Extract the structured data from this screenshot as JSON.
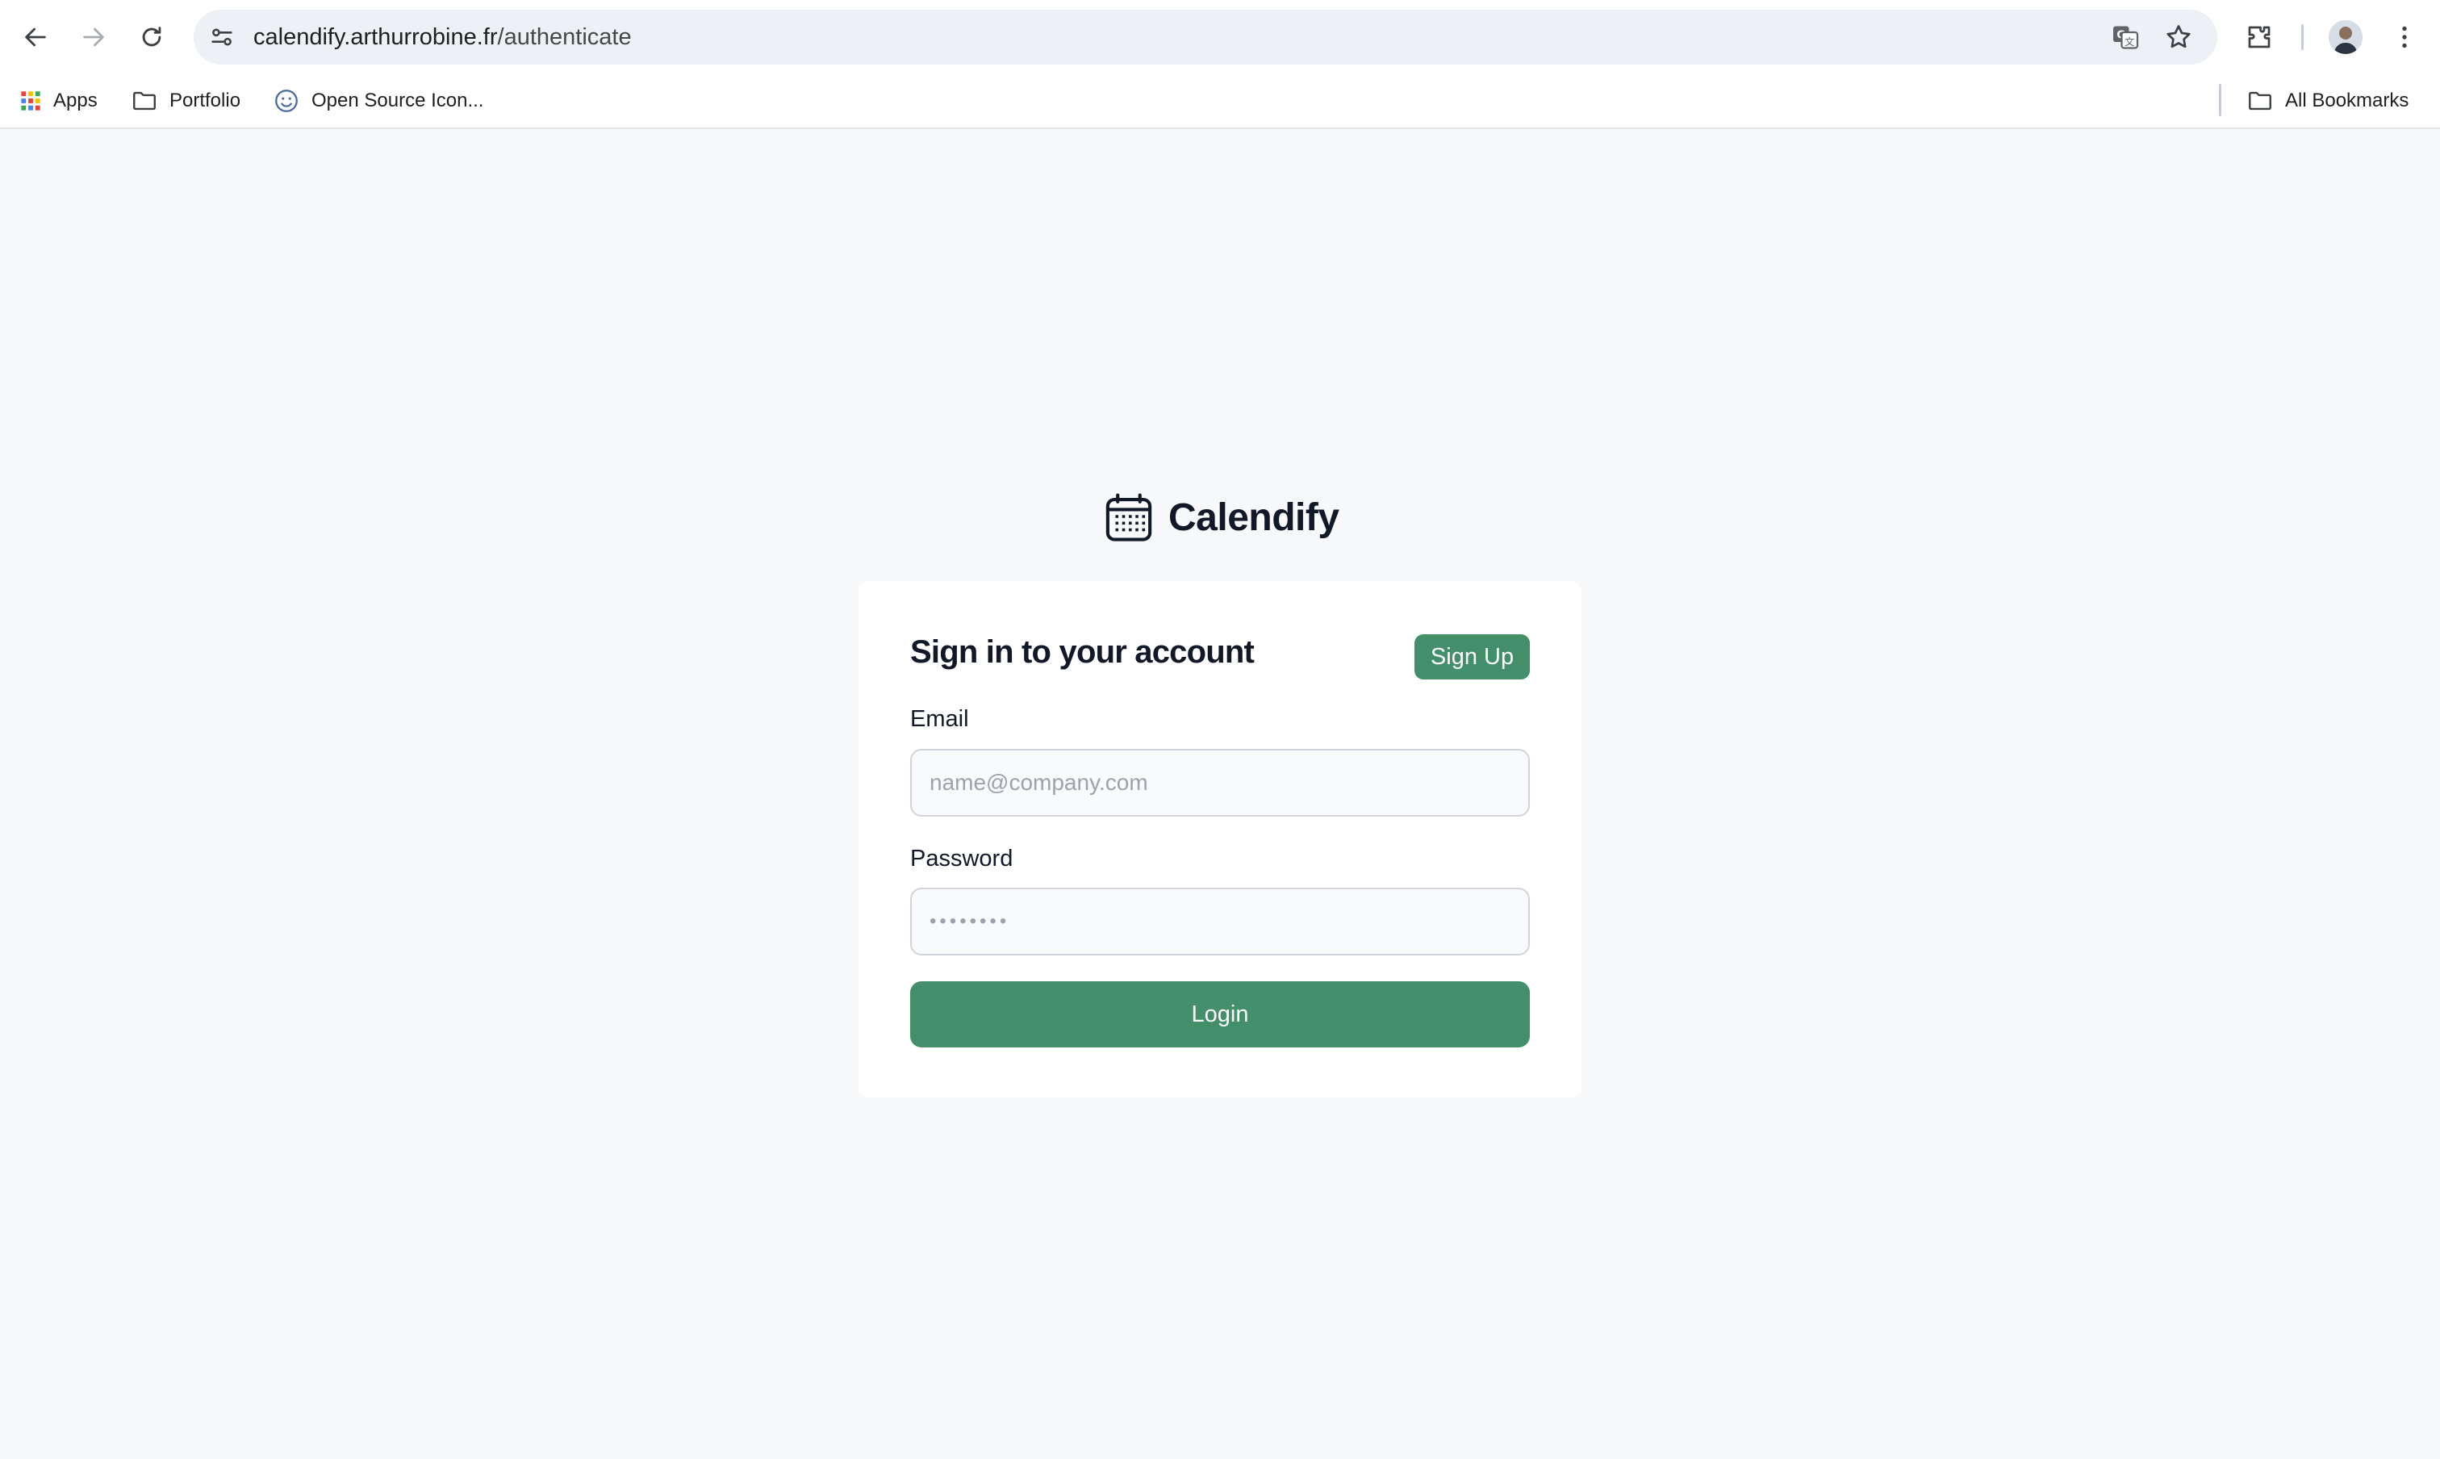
{
  "browser": {
    "url_host": "calendify.arthurrobine.fr",
    "url_path": "/authenticate",
    "icons": [
      "back-icon",
      "forward-icon",
      "reload-icon",
      "site-settings-icon",
      "translate-icon",
      "star-icon",
      "extensions-icon",
      "avatar",
      "more-icon"
    ]
  },
  "bookmarks": {
    "items": [
      {
        "label": "Apps",
        "icon": "apps-grid-icon"
      },
      {
        "label": "Portfolio",
        "icon": "folder-icon"
      },
      {
        "label": "Open Source Icon...",
        "icon": "smiley-icon"
      }
    ],
    "all_bookmarks": "All Bookmarks"
  },
  "page": {
    "brand_name": "Calendify",
    "brand_icon": "calendar-icon",
    "title": "Sign in to your account",
    "signup_label": "Sign Up",
    "email_label": "Email",
    "email_placeholder": "name@company.com",
    "password_label": "Password",
    "password_placeholder": "••••••••",
    "login_label": "Login",
    "accent_color": "#428f6a"
  }
}
